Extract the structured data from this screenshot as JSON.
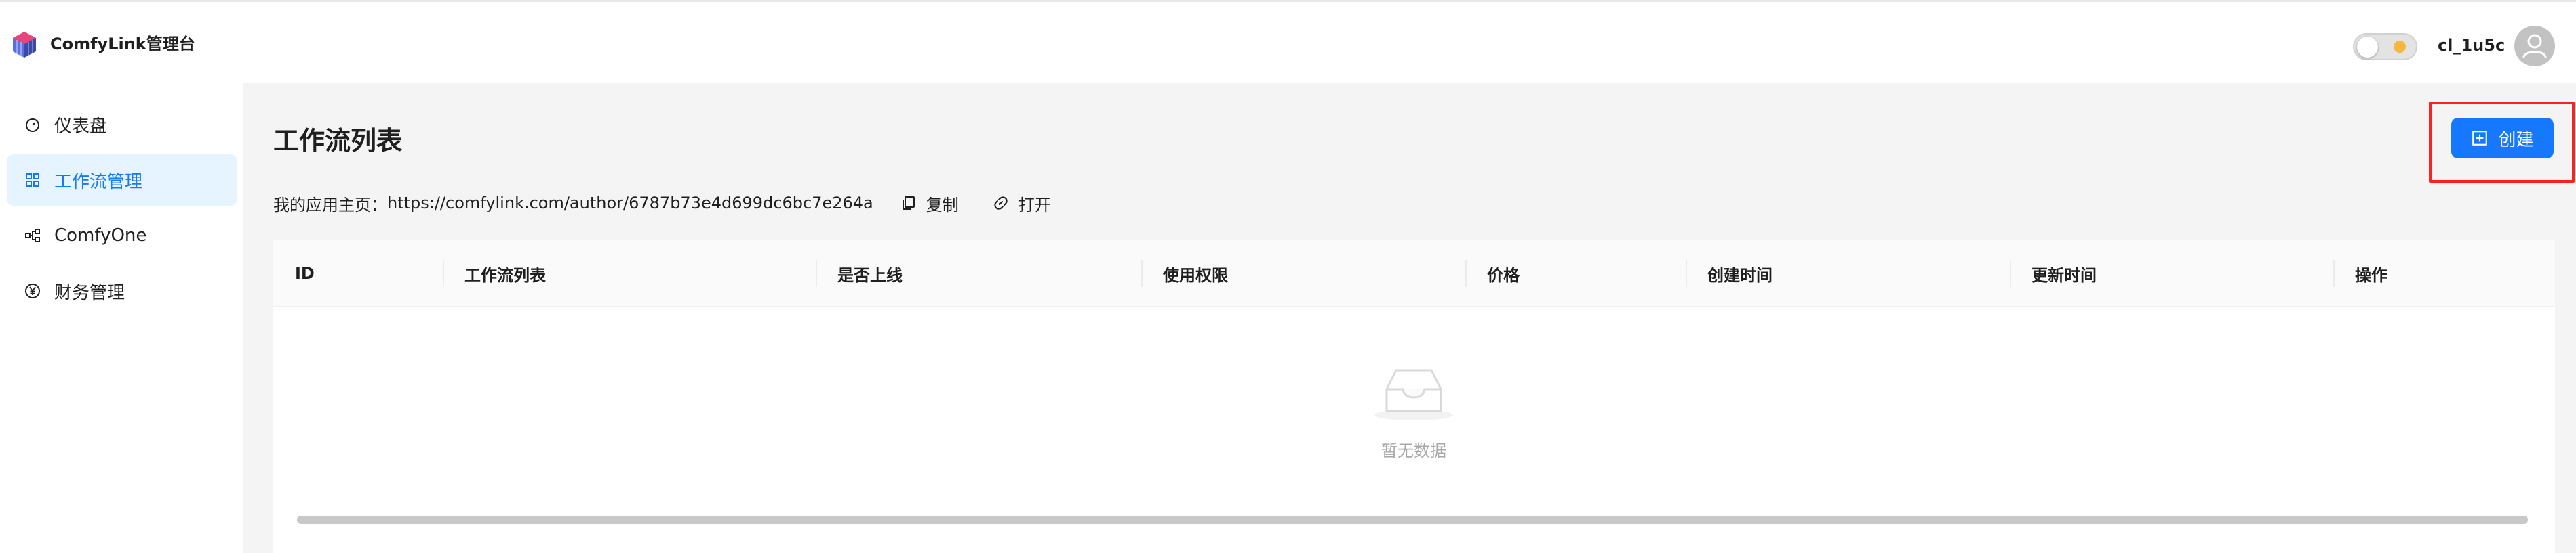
{
  "header": {
    "brand": "ComfyLink管理台",
    "username": "cl_1u5c"
  },
  "sidebar": {
    "items": [
      {
        "label": "仪表盘",
        "icon": "dashboard-icon"
      },
      {
        "label": "工作流管理",
        "icon": "grid-icon",
        "active": true
      },
      {
        "label": "ComfyOne",
        "icon": "nodes-icon"
      },
      {
        "label": "财务管理",
        "icon": "yen-icon"
      }
    ]
  },
  "main": {
    "title": "工作流列表",
    "create_label": "创建",
    "homepage_label": "我的应用主页：",
    "homepage_url": "https://comfylink.com/author/6787b73e4d699dc6bc7e264a",
    "copy_label": "复制",
    "open_label": "打开"
  },
  "table": {
    "columns": [
      "ID",
      "工作流列表",
      "是否上线",
      "使用权限",
      "价格",
      "创建时间",
      "更新时间",
      "操作"
    ],
    "rows": [],
    "empty_text": "暂无数据"
  },
  "colors": {
    "accent": "#1677ff",
    "active_bg": "#e6f4ff",
    "highlight": "#ff2020",
    "main_bg": "#f4f4f4"
  }
}
